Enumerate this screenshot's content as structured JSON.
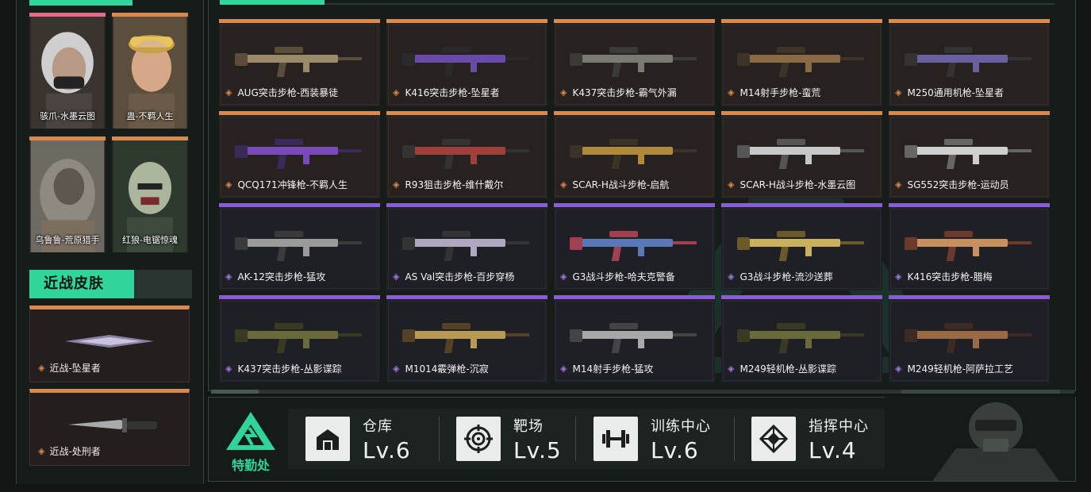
{
  "characters": [
    {
      "label": "骇爪-水墨云图",
      "rarity_color": "#e26b86"
    },
    {
      "label": "蛊-不羁人生",
      "rarity_color": "#d98a4c"
    },
    {
      "label": "乌鲁鲁-荒原猎手",
      "rarity_color": "#d98a4c"
    },
    {
      "label": "红狼-电锯惊魂",
      "rarity_color": "#d98a4c"
    }
  ],
  "melee_section": {
    "title": "近战皮肤",
    "items": [
      {
        "label": "近战-坠星者",
        "icon": "knife-icon"
      },
      {
        "label": "近战-处刑者",
        "icon": "combat-knife-icon"
      }
    ]
  },
  "weapons": [
    {
      "label": "AUG突击步枪-西装暴徒",
      "tier": "orange"
    },
    {
      "label": "K416突击步枪-坠星者",
      "tier": "orange"
    },
    {
      "label": "K437突击步枪-霸气外漏",
      "tier": "orange"
    },
    {
      "label": "M14射手步枪-蛮荒",
      "tier": "orange"
    },
    {
      "label": "M250通用机枪-坠星者",
      "tier": "orange"
    },
    {
      "label": "QCQ171冲锋枪-不羁人生",
      "tier": "orange"
    },
    {
      "label": "R93狙击步枪-维什戴尔",
      "tier": "orange"
    },
    {
      "label": "SCAR-H战斗步枪-启航",
      "tier": "orange"
    },
    {
      "label": "SCAR-H战斗步枪-水墨云图",
      "tier": "orange"
    },
    {
      "label": "SG552突击步枪-运动员",
      "tier": "orange"
    },
    {
      "label": "AK-12突击步枪-猛攻",
      "tier": "purple"
    },
    {
      "label": "AS Val突击步枪-百步穿杨",
      "tier": "purple"
    },
    {
      "label": "G3战斗步枪-哈夫克警备",
      "tier": "purple"
    },
    {
      "label": "G3战斗步枪-流沙送葬",
      "tier": "purple"
    },
    {
      "label": "K416突击步枪-腊梅",
      "tier": "purple"
    },
    {
      "label": "K437突击步枪-丛影谍踪",
      "tier": "purple"
    },
    {
      "label": "M1014霰弹枪-沉寂",
      "tier": "purple"
    },
    {
      "label": "M14射手步枪-猛攻",
      "tier": "purple"
    },
    {
      "label": "M249轻机枪-丛影谍踪",
      "tier": "purple"
    },
    {
      "label": "M249轻机枪-阿萨拉工艺",
      "tier": "purple"
    }
  ],
  "bottom_bar": {
    "logo_text": "特勤处",
    "facilities": [
      {
        "name": "仓库",
        "level": "Lv.6",
        "icon": "warehouse-icon"
      },
      {
        "name": "靶场",
        "level": "Lv.5",
        "icon": "target-icon"
      },
      {
        "name": "训练中心",
        "level": "Lv.6",
        "icon": "dumbbell-icon"
      },
      {
        "name": "指挥中心",
        "level": "Lv.4",
        "icon": "command-icon"
      }
    ]
  },
  "colors": {
    "accent": "#2fd59a",
    "orange_tier": "#d98a4c",
    "purple_tier": "#8a5cd8",
    "pink_tier": "#e26b86"
  }
}
